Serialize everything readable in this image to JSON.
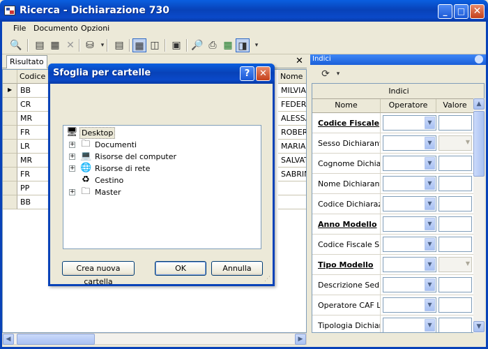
{
  "window": {
    "title": "Ricerca - Dichiarazione 730"
  },
  "menu": [
    "File",
    "Documento",
    "Opzioni"
  ],
  "toolbar_icons": [
    "search-icon",
    "edit-doc-icon",
    "properties-icon",
    "delete-icon",
    "database-icon",
    "document-icon",
    "grid-view-icon",
    "form-view-icon",
    "panel-icon",
    "print-preview-icon",
    "print-icon",
    "excel-icon",
    "layout-icon"
  ],
  "result": {
    "tab_label": "Risultato",
    "close_glyph": "✕",
    "columns": [
      "Codice Fi",
      "Nome"
    ],
    "rows": [
      {
        "codice": "BB",
        "nome": "MILVIA"
      },
      {
        "codice": "CR",
        "nome": "FEDERI"
      },
      {
        "codice": "MR",
        "nome": "ALESSA"
      },
      {
        "codice": "FR",
        "nome": "ROBER"
      },
      {
        "codice": "LR",
        "nome": "MARIA"
      },
      {
        "codice": "MR",
        "nome": "SALVAT"
      },
      {
        "codice": "FR",
        "nome": "SABRIN"
      },
      {
        "codice": "PP",
        "nome": ""
      },
      {
        "codice": "BB",
        "nome": ""
      }
    ]
  },
  "indici": {
    "panel_title": "Indici",
    "caption": "Indici",
    "columns": [
      "Nome",
      "Operatore",
      "Valore"
    ],
    "rows": [
      {
        "name": "Codice Fiscale",
        "bold": true,
        "value_is_combo": false
      },
      {
        "name": "Sesso Dichiarant",
        "bold": false,
        "value_is_combo": true
      },
      {
        "name": "Cognome Dichia",
        "bold": false,
        "value_is_combo": false
      },
      {
        "name": "Nome Dichiarant",
        "bold": false,
        "value_is_combo": false
      },
      {
        "name": "Codice Dichiaraz",
        "bold": false,
        "value_is_combo": false
      },
      {
        "name": "Anno Modello",
        "bold": true,
        "value_is_combo": false
      },
      {
        "name": "Codice Fiscale S",
        "bold": false,
        "value_is_combo": false
      },
      {
        "name": "Tipo Modello",
        "bold": true,
        "value_is_combo": true
      },
      {
        "name": "Descrizione Sed",
        "bold": false,
        "value_is_combo": false
      },
      {
        "name": "Operatore CAF L",
        "bold": false,
        "value_is_combo": false
      },
      {
        "name": "Tipologia Dichiar",
        "bold": false,
        "value_is_combo": false
      }
    ]
  },
  "dialog": {
    "title": "Sfoglia per cartelle",
    "help_glyph": "?",
    "close_glyph": "✕",
    "tree": [
      {
        "label": "Desktop",
        "icon": "desktop-icon",
        "level": 0,
        "expandable": false,
        "selected": true
      },
      {
        "label": "Documenti",
        "icon": "documents-folder-icon",
        "level": 1,
        "expandable": true
      },
      {
        "label": "Risorse del computer",
        "icon": "my-computer-icon",
        "level": 1,
        "expandable": true
      },
      {
        "label": "Risorse di rete",
        "icon": "network-icon",
        "level": 1,
        "expandable": true
      },
      {
        "label": "Cestino",
        "icon": "recycle-bin-icon",
        "level": 1,
        "expandable": false
      },
      {
        "label": "Master",
        "icon": "folder-icon",
        "level": 1,
        "expandable": true
      }
    ],
    "new_folder_button": "Crea nuova cartella",
    "ok_button": "OK",
    "cancel_button": "Annulla"
  }
}
